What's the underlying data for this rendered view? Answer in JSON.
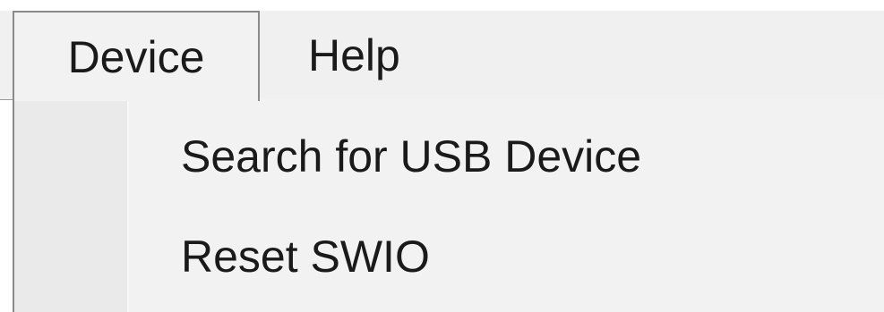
{
  "menubar": {
    "items": [
      {
        "label": "Device",
        "open": true
      },
      {
        "label": "Help",
        "open": false
      }
    ]
  },
  "dropdown": {
    "items": [
      {
        "label": "Search for USB Device"
      },
      {
        "label": "Reset SWIO"
      }
    ]
  },
  "colors": {
    "menubar_bg": "#f0f0f0",
    "dropdown_bg": "#f2f2f2",
    "gutter_bg": "#eaeaea",
    "border": "#8a8a8a",
    "text": "#1a1a1a"
  }
}
